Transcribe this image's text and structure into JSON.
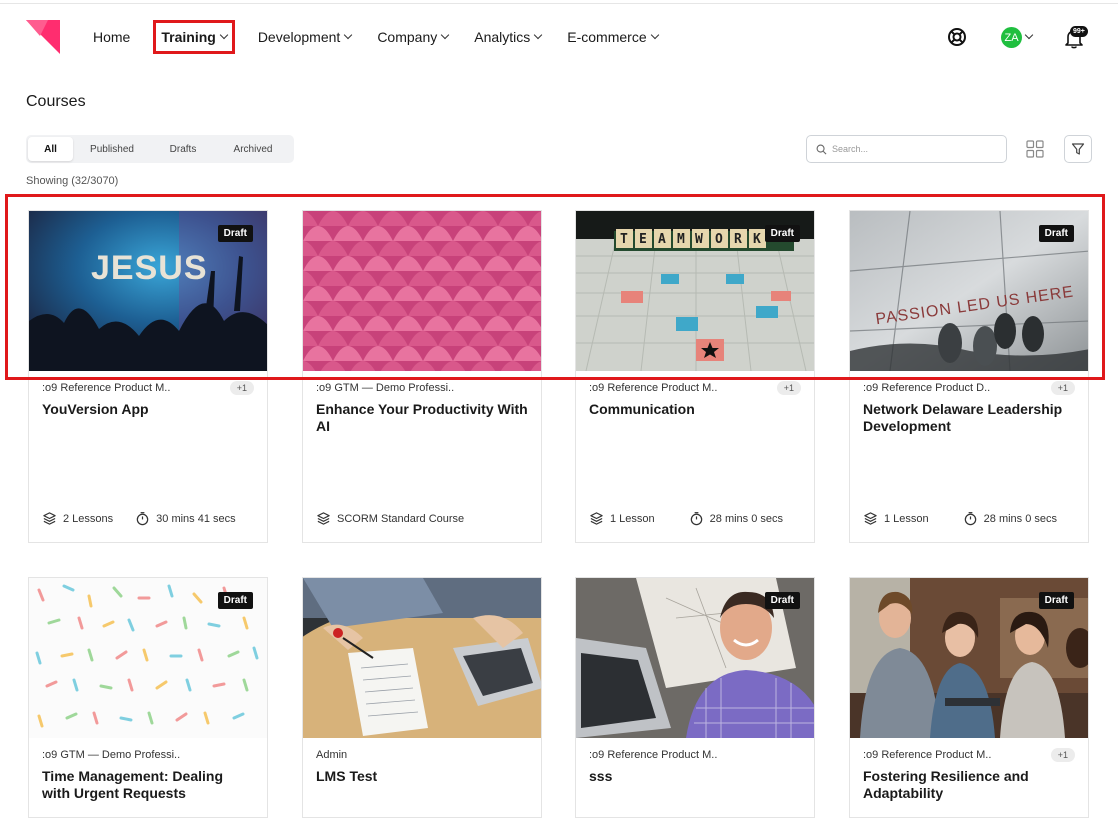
{
  "nav": {
    "items": [
      {
        "label": "Home",
        "dropdown": false,
        "active": false
      },
      {
        "label": "Training",
        "dropdown": true,
        "active": true
      },
      {
        "label": "Development",
        "dropdown": true,
        "active": false
      },
      {
        "label": "Company",
        "dropdown": true,
        "active": false
      },
      {
        "label": "Analytics",
        "dropdown": true,
        "active": false
      },
      {
        "label": "E-commerce",
        "dropdown": true,
        "active": false
      }
    ],
    "avatar_initials": "ZA",
    "notification_count": "99+",
    "brand_color": "#ff2d6f",
    "highlight_color": "#e0181b"
  },
  "page": {
    "title": "Courses",
    "filters": [
      "All",
      "Published",
      "Drafts",
      "Archived"
    ],
    "selected_filter": "All",
    "search_placeholder": "Search...",
    "showing": "Showing (32/3070)"
  },
  "icons": {
    "help": "lifebuoy-icon",
    "notifications": "bell-icon",
    "search": "search-icon",
    "view": "grid-view-icon",
    "filter": "funnel-icon",
    "lessons": "layers-icon",
    "duration": "stopwatch-icon"
  },
  "cards": [
    {
      "badge": "Draft",
      "tag": ":o9 Reference Product M..",
      "extra": "+1",
      "title": "YouVersion App",
      "lessons": "2 Lessons",
      "duration": "30 mins 41 secs",
      "thumb": "concert"
    },
    {
      "badge": "",
      "tag": ":o9 GTM — Demo Professi..",
      "extra": "",
      "title": "Enhance Your Productivity With AI",
      "lessons": "SCORM Standard Course",
      "duration": "",
      "thumb": "pink-scales"
    },
    {
      "badge": "Draft",
      "tag": ":o9 Reference Product M..",
      "extra": "+1",
      "title": "Communication",
      "lessons": "1 Lesson",
      "duration": "28 mins 0 secs",
      "thumb": "scrabble"
    },
    {
      "badge": "Draft",
      "tag": ":o9 Reference Product D..",
      "extra": "+1",
      "title": "Network Delaware Leadership Development",
      "lessons": "1 Lesson",
      "duration": "28 mins 0 secs",
      "thumb": "passion"
    },
    {
      "badge": "Draft",
      "tag": ":o9 GTM — Demo Professi..",
      "extra": "",
      "title": "Time Management: Dealing with Urgent Requests",
      "lessons": "",
      "duration": "",
      "thumb": "sprinkles"
    },
    {
      "badge": "",
      "tag": "Admin",
      "extra": "",
      "title": "LMS Test",
      "lessons": "",
      "duration": "",
      "thumb": "desk"
    },
    {
      "badge": "Draft",
      "tag": ":o9 Reference Product M..",
      "extra": "",
      "title": "sss",
      "lessons": "",
      "duration": "",
      "thumb": "man"
    },
    {
      "badge": "Draft",
      "tag": ":o9 Reference Product M..",
      "extra": "+1",
      "title": "Fostering Resilience and Adaptability",
      "lessons": "",
      "duration": "",
      "thumb": "group"
    }
  ]
}
